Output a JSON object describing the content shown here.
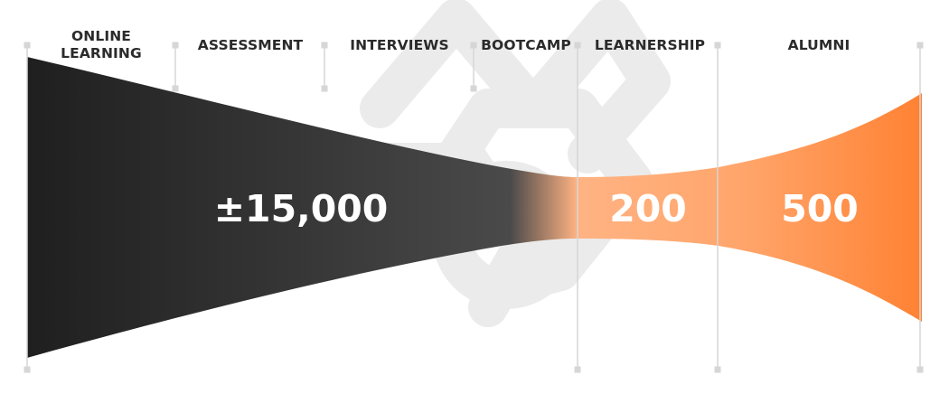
{
  "stages": [
    {
      "label_line1": "ONLINE",
      "label_line2": "LEARNING"
    },
    {
      "label_line1": "ASSESSMENT",
      "label_line2": ""
    },
    {
      "label_line1": "INTERVIEWS",
      "label_line2": ""
    },
    {
      "label_line1": "BOOTCAMP",
      "label_line2": ""
    },
    {
      "label_line1": "LEARNERSHIP",
      "label_line2": ""
    },
    {
      "label_line1": "ALUMNI",
      "label_line2": ""
    }
  ],
  "stats": {
    "intake": "±15,000",
    "learnership": "200",
    "alumni": "500"
  },
  "colors": {
    "funnel_dark": "#2a2a2a",
    "funnel_mid": "#4a4a4a",
    "funnel_orange_light": "#ffb383",
    "funnel_orange": "#ff8a3d",
    "divider": "#d6d6d6",
    "watermark": "#ebebeb",
    "label_text": "#2b2b2b"
  },
  "icons": {
    "watermark": "interlocking-knot-logo-icon"
  }
}
